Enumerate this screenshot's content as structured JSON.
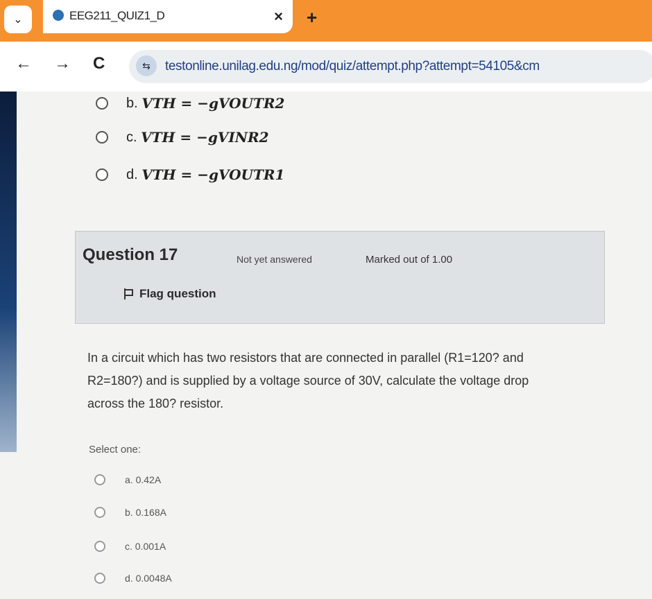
{
  "browser": {
    "tab_title": "EEG211_QUIZ1_D",
    "tab_close": "×",
    "new_tab": "+",
    "menu": "⌄",
    "back": "←",
    "forward": "→",
    "reload": "C",
    "url": "testonline.unilag.edu.ng/mod/quiz/attempt.php?attempt=54105&cm"
  },
  "prev_question": {
    "options": [
      {
        "label": "b.",
        "eq": "VTH = −gVOUTR2"
      },
      {
        "label": "c.",
        "eq": "VTH = −gVINR2"
      },
      {
        "label": "d.",
        "eq": "VTH = −gVOUTR1"
      }
    ]
  },
  "question": {
    "number": "Question 17",
    "state": "Not yet answered",
    "mark": "Marked out of 1.00",
    "flag": "Flag question",
    "text": "In a circuit which has two resistors that are connected in parallel (R1=120? and R2=180?) and is supplied by a voltage source of 30V, calculate the voltage drop across the 180? resistor.",
    "select_prompt": "Select one:",
    "answers": [
      "a. 0.42A",
      "b. 0.168A",
      "c. 0.001A",
      "d. 0.0048A"
    ]
  },
  "colors": {
    "tabbar": "#f5922f",
    "url": "#1f3f86"
  }
}
